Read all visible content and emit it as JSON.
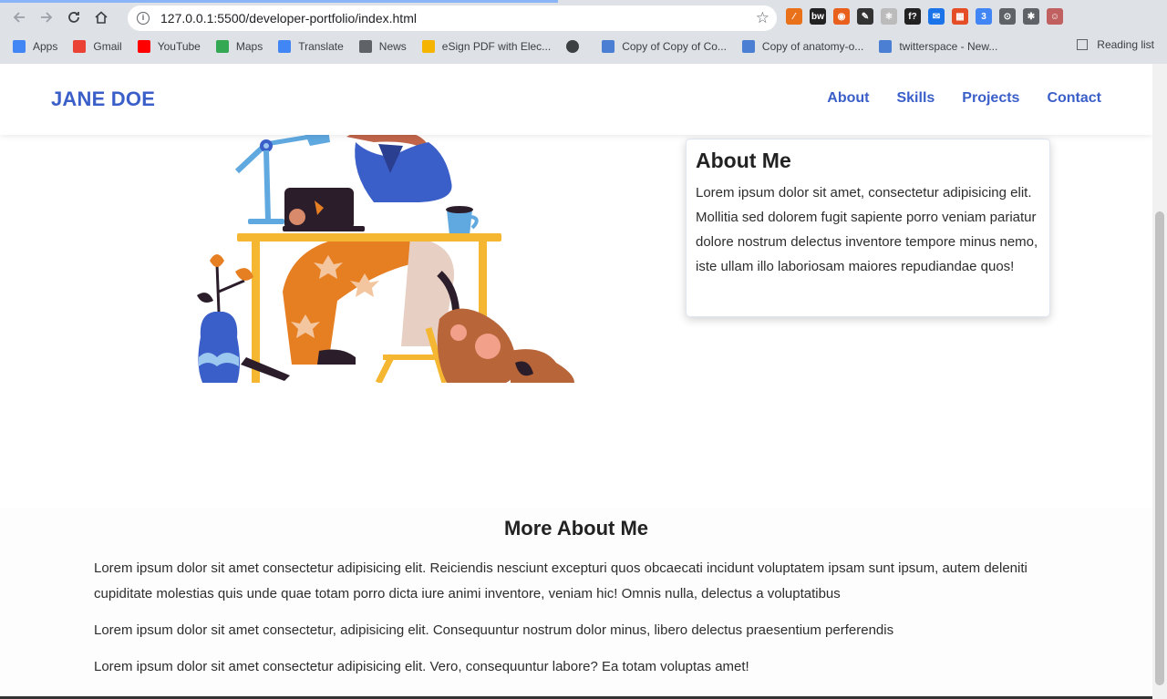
{
  "browser": {
    "url": "127.0.0.1:5500/developer-portfolio/index.html",
    "bookmarks": [
      {
        "label": "Apps",
        "color": "#4285f4"
      },
      {
        "label": "Gmail",
        "color": "#ea4335"
      },
      {
        "label": "YouTube",
        "color": "#ff0000"
      },
      {
        "label": "Maps",
        "color": "#34a853"
      },
      {
        "label": "Translate",
        "color": "#4285f4"
      },
      {
        "label": "News",
        "color": "#5f6368"
      },
      {
        "label": "eSign PDF with Elec...",
        "color": "#f4b400"
      },
      {
        "label": "",
        "color": "#3c4043"
      },
      {
        "label": "Copy of Copy of Co...",
        "color": "#4a7fd4"
      },
      {
        "label": "Copy of anatomy-o...",
        "color": "#4a7fd4"
      },
      {
        "label": "twitterspace - New...",
        "color": "#4a7fd4"
      }
    ],
    "reading_list": "Reading list",
    "extensions": [
      {
        "text": "⁄",
        "color": "#e8711a"
      },
      {
        "text": "bw",
        "color": "#222222"
      },
      {
        "text": "◉",
        "color": "#e8601c"
      },
      {
        "text": "✎",
        "color": "#333333"
      },
      {
        "text": "⚛",
        "color": "#bbbbbb"
      },
      {
        "text": "f?",
        "color": "#222222"
      },
      {
        "text": "✉",
        "color": "#1a73e8"
      },
      {
        "text": "▦",
        "color": "#e44d26"
      },
      {
        "text": "3",
        "color": "#4285f4"
      },
      {
        "text": "⊙",
        "color": "#5f6368"
      },
      {
        "text": "✱",
        "color": "#5f6368"
      },
      {
        "text": "☺",
        "color": "#c06060"
      }
    ]
  },
  "site": {
    "logo": "JANE DOE",
    "nav": [
      "About",
      "Skills",
      "Projects",
      "Contact"
    ],
    "about": {
      "title": "About Me",
      "text": "Lorem ipsum dolor sit amet, consectetur adipisicing elit. Mollitia sed dolorem fugit sapiente porro veniam pariatur dolore nostrum delectus inventore tempore minus nemo, iste ullam illo laboriosam maiores repudiandae quos!"
    },
    "more": {
      "title": "More About Me",
      "paragraphs": [
        "Lorem ipsum dolor sit amet consectetur adipisicing elit. Reiciendis nesciunt excepturi quos obcaecati incidunt voluptatem ipsam sunt ipsum, autem deleniti cupiditate molestias quis unde quae totam porro dicta iure animi inventore, veniam hic! Omnis nulla, delectus a voluptatibus",
        "Lorem ipsum dolor sit amet consectetur, adipisicing elit. Consequuntur nostrum dolor minus, libero delectus praesentium perferendis",
        "Lorem ipsum dolor sit amet consectetur adipisicing elit. Vero, consequuntur labore? Ea totam voluptas amet!"
      ]
    },
    "colors": {
      "accent": "#3b5fc9"
    }
  }
}
